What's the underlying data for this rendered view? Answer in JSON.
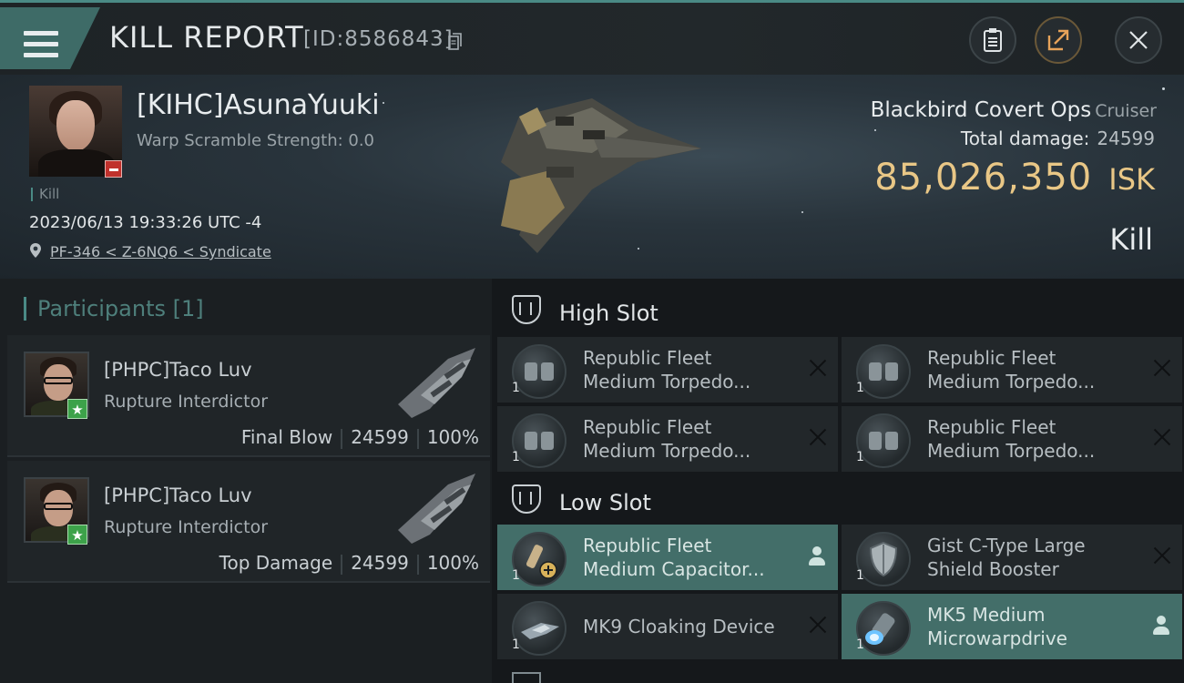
{
  "header": {
    "title": "KILL REPORT",
    "report_id": "[ID:8586843]"
  },
  "victim": {
    "name": "[KIHC]AsunaYuuki",
    "warp_scramble": "Warp Scramble Strength: 0.0",
    "kill_tag": "Kill",
    "datetime": "2023/06/13 19:33:26 UTC -4",
    "location": "PF-346 < Z-6NQ6 < Syndicate"
  },
  "ship": {
    "name": "Blackbird Covert Ops",
    "class": "Cruiser",
    "total_damage_label": "Total damage:",
    "total_damage": "24599",
    "isk_value": "85,026,350",
    "isk_unit": "ISK",
    "result": "Kill"
  },
  "participants": {
    "title": "Participants [1]",
    "items": [
      {
        "name": "[PHPC]Taco Luv",
        "ship": "Rupture Interdictor",
        "role": "Final Blow",
        "damage": "24599",
        "percent": "100%"
      },
      {
        "name": "[PHPC]Taco Luv",
        "ship": "Rupture Interdictor",
        "role": "Top Damage",
        "damage": "24599",
        "percent": "100%"
      }
    ]
  },
  "slots": {
    "high": {
      "label": "High Slot",
      "items": [
        {
          "line1": "Republic Fleet",
          "line2": "Medium Torpedo...",
          "qty": "1"
        },
        {
          "line1": "Republic Fleet",
          "line2": "Medium Torpedo...",
          "qty": "1"
        },
        {
          "line1": "Republic Fleet",
          "line2": "Medium Torpedo...",
          "qty": "1"
        },
        {
          "line1": "Republic Fleet",
          "line2": "Medium Torpedo...",
          "qty": "1"
        }
      ]
    },
    "low": {
      "label": "Low Slot",
      "items": [
        {
          "line1": "Republic Fleet",
          "line2": "Medium Capacitor...",
          "qty": "1"
        },
        {
          "line1": "Gist C-Type Large",
          "line2": "Shield Booster",
          "qty": "1"
        },
        {
          "line1": "MK9 Cloaking Device",
          "line2": "",
          "qty": "1"
        },
        {
          "line1": "MK5 Medium",
          "line2": "Microwarpdrive",
          "qty": "1"
        }
      ]
    }
  },
  "colors": {
    "accent_teal": "#4a8a85",
    "isk_gold": "#e9c786",
    "highlight_item": "#436e69",
    "loss_badge": "#c0312c",
    "star_badge": "#3da24a"
  },
  "icons": [
    "menu-icon",
    "copy-icon",
    "clipboard-icon",
    "share-icon",
    "close-icon",
    "location-pin-icon",
    "slot-icon",
    "person-icon",
    "remove-icon"
  ]
}
